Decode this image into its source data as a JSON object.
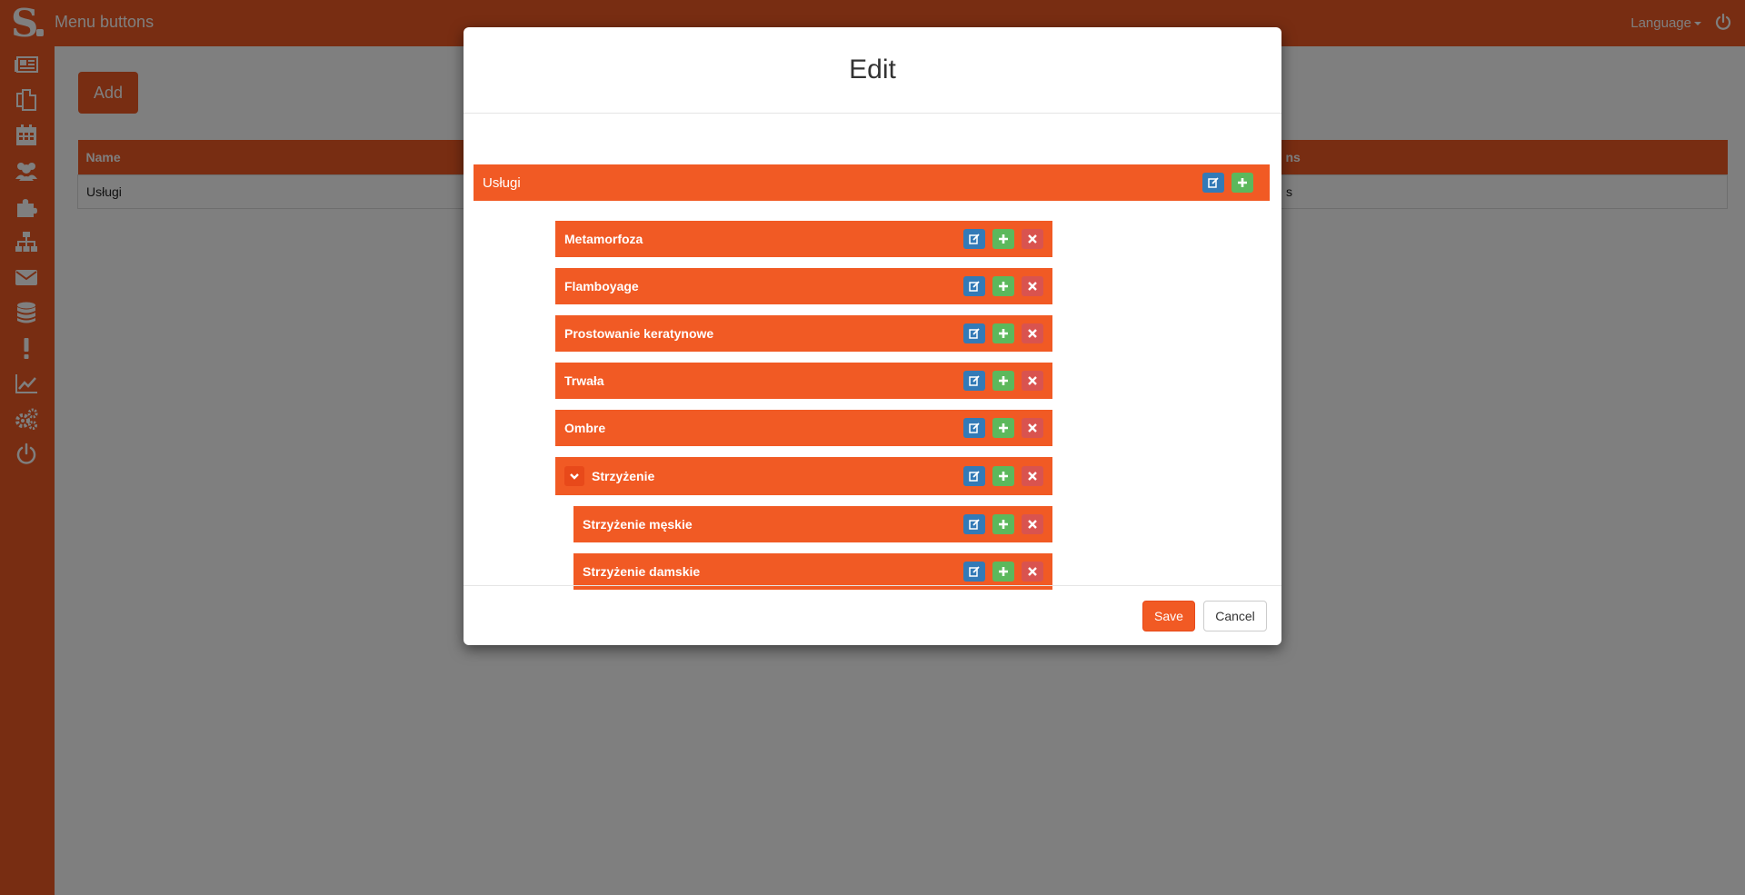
{
  "app": {
    "title": "Menu buttons",
    "language_label": "Language",
    "brand_color": "#f15a24"
  },
  "sidebar": {
    "items": [
      {
        "icon": "newspaper-icon"
      },
      {
        "icon": "pages-icon"
      },
      {
        "icon": "calendar-icon"
      },
      {
        "icon": "users-icon"
      },
      {
        "icon": "puzzle-icon"
      },
      {
        "icon": "sitemap-icon"
      },
      {
        "icon": "envelope-icon"
      },
      {
        "icon": "database-icon"
      },
      {
        "icon": "exclamation-icon"
      },
      {
        "icon": "line-chart-icon"
      },
      {
        "icon": "cogs-icon"
      },
      {
        "icon": "power-icon"
      }
    ]
  },
  "page": {
    "add_label": "Add",
    "table": {
      "columns": [
        "Name",
        "ns"
      ],
      "rows": [
        [
          "Usługi",
          "s"
        ]
      ]
    }
  },
  "modal": {
    "title": "Edit",
    "tree": {
      "root": {
        "label": "Usługi"
      },
      "children": [
        {
          "label": "Metamorfoza"
        },
        {
          "label": "Flamboyage"
        },
        {
          "label": "Prostowanie keratynowe"
        },
        {
          "label": "Trwała"
        },
        {
          "label": "Ombre"
        },
        {
          "label": "Strzyżenie",
          "expanded": true
        },
        {
          "label": "Strzyżenie męskie",
          "parent": "Strzyżenie"
        },
        {
          "label": "Strzyżenie damskie",
          "parent": "Strzyżenie"
        }
      ]
    },
    "save_label": "Save",
    "cancel_label": "Cancel"
  }
}
